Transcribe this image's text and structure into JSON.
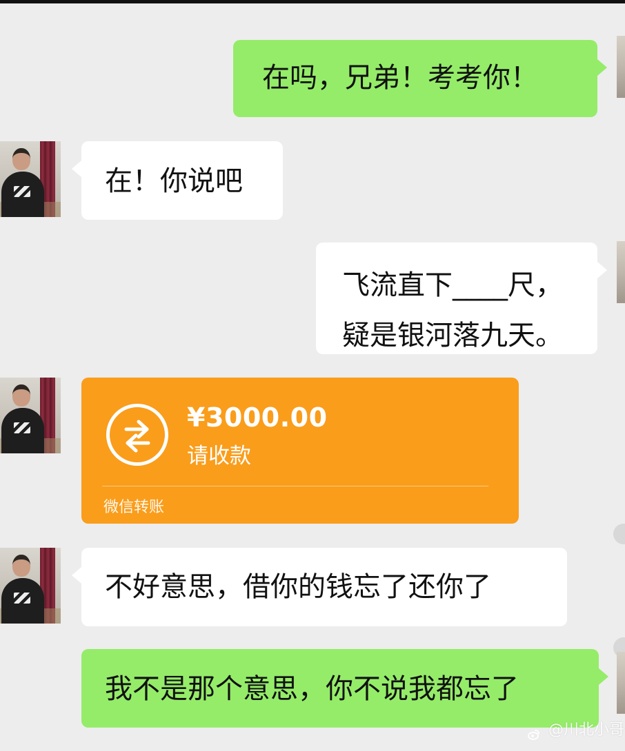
{
  "messages": [
    {
      "side": "right",
      "kind": "text",
      "text": "在吗，兄弟！考考你！"
    },
    {
      "side": "left",
      "kind": "text",
      "text": "在！你说吧"
    },
    {
      "side": "right",
      "kind": "text",
      "lines": [
        "飞流直下____尺，",
        "疑是银河落九天。"
      ]
    },
    {
      "side": "left",
      "kind": "transfer",
      "amount": "¥3000.00",
      "status": "请收款",
      "footer": "微信转账"
    },
    {
      "side": "left",
      "kind": "text",
      "text": "不好意思，借你的钱忘了还你了"
    },
    {
      "side": "right",
      "kind": "text",
      "text": "我不是那个意思，你不说我都忘了"
    }
  ],
  "watermark": {
    "text": "@川北小哥"
  },
  "colors": {
    "background": "#ededed",
    "green_bubble": "#95ec69",
    "white_bubble": "#ffffff",
    "transfer_orange": "#fa9d1b"
  },
  "icons": {
    "transfer": "transfer-arrows-icon",
    "watermark": "weibo-icon"
  }
}
